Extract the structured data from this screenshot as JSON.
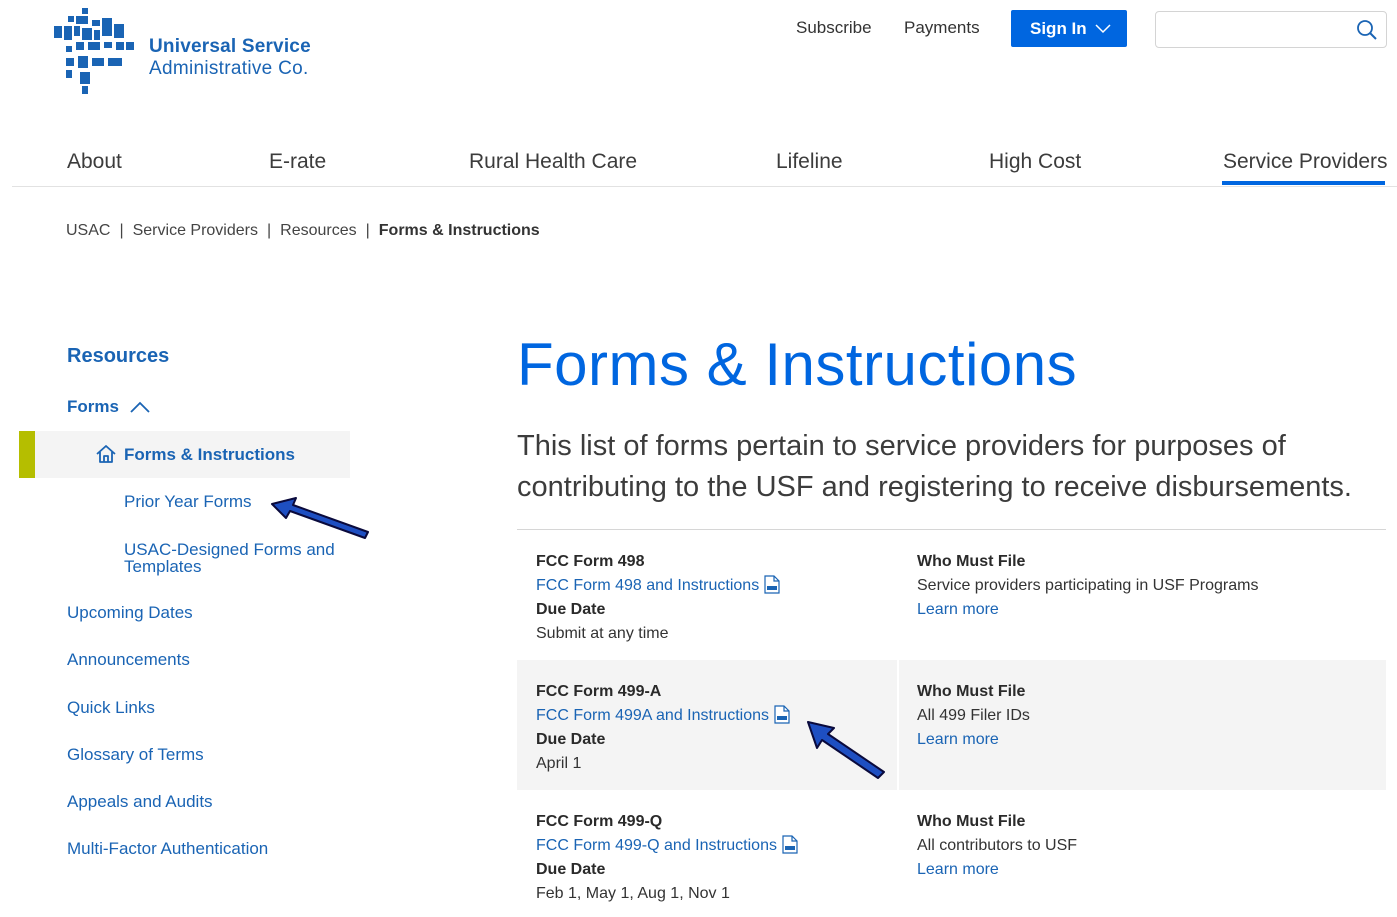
{
  "header": {
    "logo_line1": "Universal Service",
    "logo_line2": "Administrative Co.",
    "subscribe": "Subscribe",
    "payments": "Payments",
    "sign_in": "Sign In",
    "search_placeholder": ""
  },
  "nav": {
    "items": [
      "About",
      "E-rate",
      "Rural Health Care",
      "Lifeline",
      "High Cost",
      "Service Providers"
    ],
    "active": "Service Providers"
  },
  "breadcrumb": {
    "items": [
      "USAC",
      "Service Providers",
      "Resources"
    ],
    "current": "Forms & Instructions"
  },
  "sidebar": {
    "title": "Resources",
    "forms_label": "Forms",
    "active_label": "Forms & Instructions",
    "sub_links": [
      "Prior Year Forms",
      "USAC-Designed Forms and Templates"
    ],
    "links": [
      "Upcoming Dates",
      "Announcements",
      "Quick Links",
      "Glossary of Terms",
      "Appeals and Audits",
      "Multi-Factor Authentication"
    ]
  },
  "main": {
    "title": "Forms & Instructions",
    "intro": "This list of forms pertain to service providers for purposes of contributing to the USF and registering to receive disbursements."
  },
  "forms": [
    {
      "name": "FCC Form 498",
      "link": "FCC Form 498 and Instructions",
      "due_label": "Due Date",
      "due": "Submit at any time",
      "who_label": "Who Must File",
      "who": "Service providers participating in USF Programs",
      "learn_more": "Learn more"
    },
    {
      "name": "FCC Form 499-A",
      "link": "FCC Form 499A and Instructions",
      "due_label": "Due Date",
      "due": "April 1",
      "who_label": "Who Must File",
      "who": "All 499 Filer IDs",
      "learn_more": "Learn more"
    },
    {
      "name": "FCC Form 499-Q",
      "link": "FCC Form 499-Q and Instructions",
      "due_label": "Due Date",
      "due": "Feb 1, May 1, Aug 1, Nov 1",
      "who_label": "Who Must File",
      "who": "All contributors to USF",
      "learn_more": "Learn more"
    }
  ],
  "colors": {
    "brand_blue": "#1a64b4",
    "accent_blue": "#0066e0",
    "active_bar": "#b5be00",
    "arrow_fill": "#1e4fc2"
  }
}
